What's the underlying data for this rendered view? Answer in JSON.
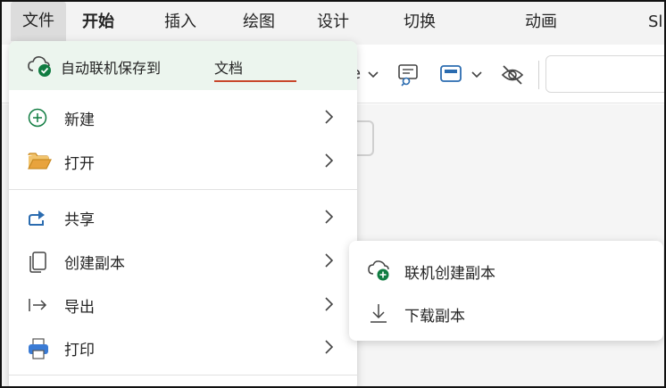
{
  "ribbon": {
    "tabs": [
      {
        "label": "文件"
      },
      {
        "label": "开始"
      },
      {
        "label": "插入"
      },
      {
        "label": "绘图"
      },
      {
        "label": "设计"
      },
      {
        "label": "切换"
      },
      {
        "label": "动画"
      },
      {
        "label": "Sl"
      }
    ]
  },
  "toolbar": {
    "peek_text": "e"
  },
  "file_menu": {
    "autosave": {
      "label": "自动联机保存到",
      "location": "文档"
    },
    "items": [
      {
        "label": "新建",
        "icon": "plus-circle-icon"
      },
      {
        "label": "打开",
        "icon": "folder-icon"
      },
      {
        "label": "共享",
        "icon": "share-icon"
      },
      {
        "label": "创建副本",
        "icon": "copy-icon"
      },
      {
        "label": "导出",
        "icon": "export-icon"
      },
      {
        "label": "打印",
        "icon": "printer-icon"
      }
    ]
  },
  "copy_submenu": {
    "items": [
      {
        "label": "联机创建副本",
        "icon": "cloud-add-icon"
      },
      {
        "label": "下载副本",
        "icon": "download-icon"
      }
    ]
  },
  "colors": {
    "accent_green": "#107c41",
    "autosave_bg": "#ecf5ee",
    "underline_red": "#c8472b",
    "share_blue": "#2b6cb0",
    "folder_orange": "#e8a33d"
  }
}
